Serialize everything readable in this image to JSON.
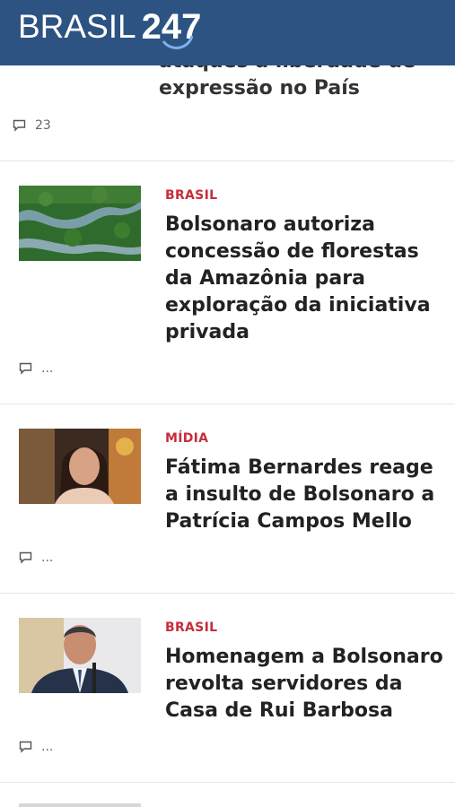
{
  "header": {
    "brand_text": "BRASIL",
    "brand_number": "247"
  },
  "previous_article": {
    "title_tail": "ataques à liberdade de expressão no País",
    "comment_count": "23"
  },
  "articles": [
    {
      "category": "BRASIL",
      "title": "Bolsonaro autoriza concessão de florestas da Amazônia para exploração da iniciativa privada",
      "comments": "...",
      "image": "amazon-river-aerial"
    },
    {
      "category": "MÍDIA",
      "title": "Fátima Bernardes reage a insulto de Bolsonaro a Patrícia Campos Mello",
      "comments": "...",
      "image": "woman-portrait"
    },
    {
      "category": "BRASIL",
      "title": "Homenagem a Bolsonaro revolta servidores da Casa de Rui Barbosa",
      "comments": "...",
      "image": "man-speaking-portrait"
    }
  ],
  "colors": {
    "header_bg": "#2d5382",
    "category": "#c62d3a",
    "title": "#222222"
  }
}
